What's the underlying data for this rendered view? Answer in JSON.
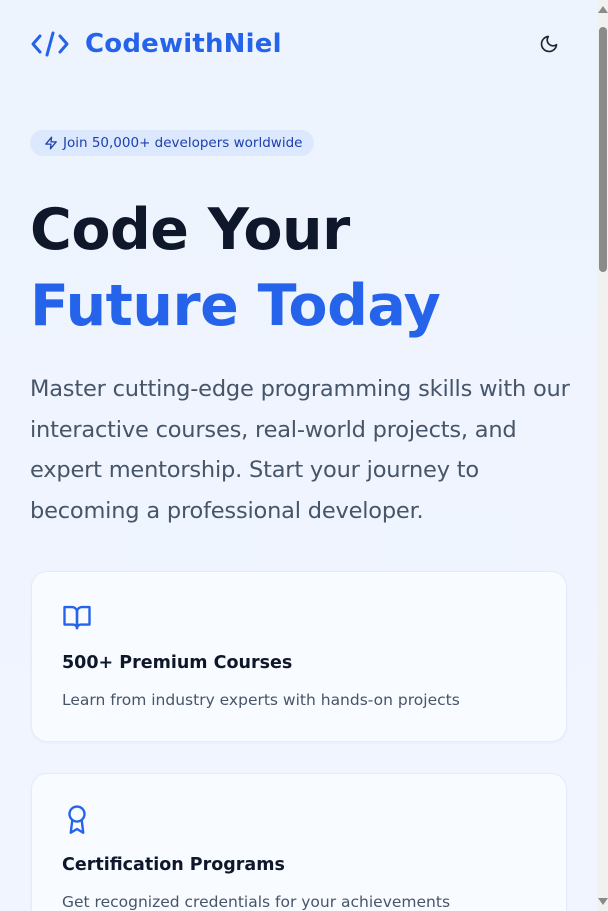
{
  "header": {
    "brand": "CodewithNiel",
    "logo_icon": "code-brackets-icon",
    "theme_toggle_icon": "moon-icon"
  },
  "badge": {
    "icon": "lightning-icon",
    "text": "Join 50,000+ developers worldwide"
  },
  "hero": {
    "title_line1": "Code Your",
    "title_line2": "Future Today",
    "description": "Master cutting-edge programming skills with our interactive courses, real-world projects, and expert mentorship. Start your journey to becoming a professional developer."
  },
  "features": [
    {
      "icon": "book-open-icon",
      "title": "500+ Premium Courses",
      "description": "Learn from industry experts with hands-on projects"
    },
    {
      "icon": "award-ribbon-icon",
      "title": "Certification Programs",
      "description": "Get recognized credentials for your achievements"
    }
  ],
  "colors": {
    "accent": "#2563eb",
    "heading": "#0f172a",
    "body_text": "#475569",
    "background": "#eff5ff",
    "badge_bg": "#dbe8fe"
  }
}
